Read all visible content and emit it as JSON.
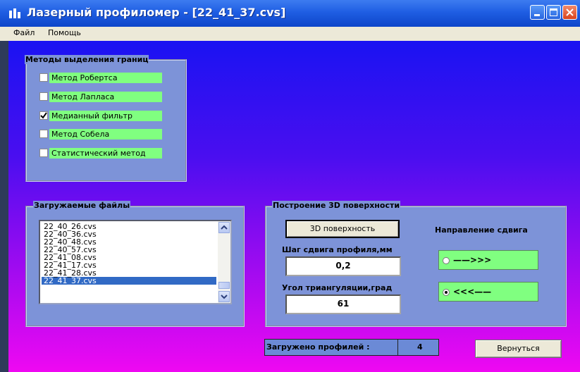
{
  "window": {
    "title": "Лазерный профиломер - [22_41_37.cvs]",
    "accent": "#1f5ee3"
  },
  "menu": {
    "items": [
      "Файл",
      "Помощь"
    ]
  },
  "edge_methods": {
    "legend": "Методы выделения границ",
    "options": [
      {
        "label": "Метод Робертса",
        "checked": false
      },
      {
        "label": "Метод Лапласа",
        "checked": false
      },
      {
        "label": "Медианный фильтр",
        "checked": true
      },
      {
        "label": "Метод Собела",
        "checked": false
      },
      {
        "label": "Статистический метод",
        "checked": false
      }
    ]
  },
  "files": {
    "legend": "Загружаемые файлы",
    "items": [
      "22_40_26.cvs",
      "22_40_36.cvs",
      "22_40_48.cvs",
      "22_40_57.cvs",
      "22_41_08.cvs",
      "22_41_17.cvs",
      "22_41_28.cvs",
      "22_41_37.cvs"
    ],
    "selected": "22_41_37.cvs"
  },
  "surface": {
    "legend": "Построение 3D поверхности",
    "build_button": "3D поверхность",
    "shift_direction_label": "Направление сдвига",
    "step_label": "Шаг сдвига профиля,мм",
    "step_value": "0,2",
    "angle_label": "Угол триангуляции,град",
    "angle_value": "61",
    "direction_options": [
      {
        "label": "——>>>",
        "selected": false
      },
      {
        "label": "<<<——",
        "selected": true
      }
    ]
  },
  "status": {
    "loaded_label": "Загружено профилей :",
    "loaded_count": "4"
  },
  "back_button": "Вернуться"
}
